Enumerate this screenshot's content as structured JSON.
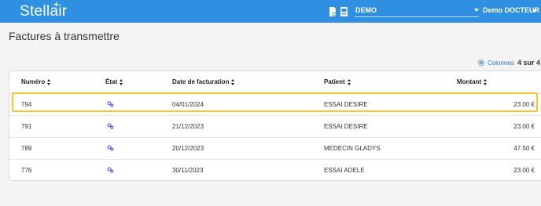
{
  "header": {
    "logo_text": "Stellair",
    "demo_select_value": "DEMO",
    "user_label": "Demo DOCTEUR"
  },
  "page": {
    "title": "Factures à transmettre",
    "columns_button": "Colonnes",
    "count_text": "4 sur 4"
  },
  "table": {
    "headers": {
      "numero": "Numéro",
      "etat": "État",
      "date": "Date de facturation",
      "patient": "Patient",
      "montant": "Montant"
    },
    "rows": [
      {
        "numero": "794",
        "etat_icon": "status-gears-icon",
        "date": "04/01/2024",
        "patient": "ESSAI DESIRE",
        "montant": "23.00 €"
      },
      {
        "numero": "791",
        "etat_icon": "status-gears-icon",
        "date": "21/12/2023",
        "patient": "ESSAI DESIRE",
        "montant": "23.00 €"
      },
      {
        "numero": "789",
        "etat_icon": "status-gears-icon",
        "date": "20/12/2023",
        "patient": "MEDECIN GLADYS",
        "montant": "47.50 €"
      },
      {
        "numero": "776",
        "etat_icon": "status-gears-icon",
        "date": "30/11/2023",
        "patient": "ESSAI ADELE",
        "montant": "23.00 €"
      }
    ]
  },
  "colors": {
    "topbar": "#2f8fe0",
    "highlight": "#f4c531",
    "status_icon": "#3b4fe0",
    "link": "#2f72c8"
  }
}
